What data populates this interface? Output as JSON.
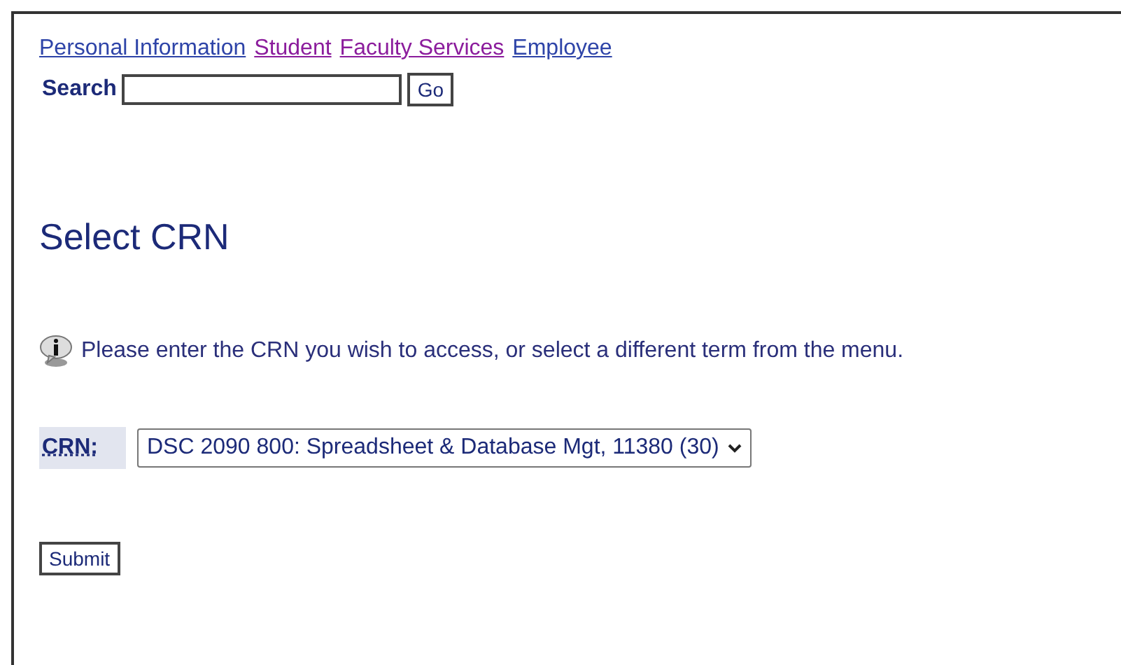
{
  "nav_links": [
    {
      "label": "Personal Information",
      "visited": false
    },
    {
      "label": "Student",
      "visited": true
    },
    {
      "label": "Faculty Services",
      "visited": true
    },
    {
      "label": "Employee",
      "visited": false
    }
  ],
  "search": {
    "label": "Search",
    "button": "Go"
  },
  "title": "Select CRN",
  "info": "Please enter the CRN you wish to access, or select a different term from the menu.",
  "crn": {
    "label": "CRN:",
    "value": "DSC 2090 800: Spreadsheet & Database Mgt, 11380 (30)"
  },
  "submit": "Submit"
}
